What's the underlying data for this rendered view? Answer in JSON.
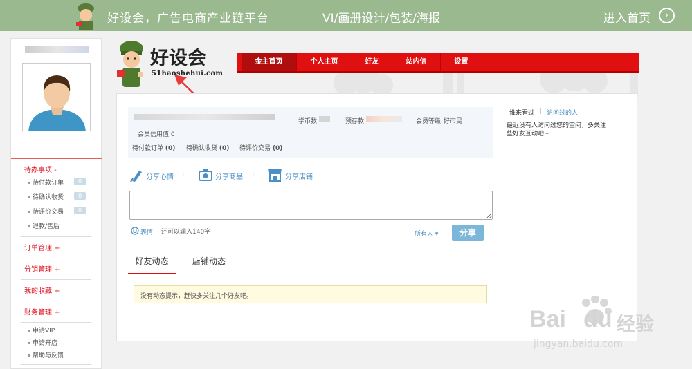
{
  "banner": {
    "title": "好设会，广告电商产业链平台",
    "subtitle": "VI/画册设计/包装/海报",
    "enter": "进入首页",
    "arrow": "›"
  },
  "sidebar": {
    "username": "··· ·····",
    "todo": {
      "label": "待办事项 -",
      "items": [
        {
          "label": "待付款订单",
          "count": "0"
        },
        {
          "label": "待确认收货",
          "count": "0"
        },
        {
          "label": "待评价交易",
          "count": "0"
        },
        {
          "label": "退款/售后"
        }
      ]
    },
    "orders": "订单管理 +",
    "dist": "分销管理 +",
    "fav": "我的收藏 +",
    "finance": "财务管理 +",
    "links": [
      "申请VIP",
      "申请开店",
      "帮助与反馈"
    ]
  },
  "logo": {
    "name": "好设会",
    "domain": "51haoshehui.com"
  },
  "nav": {
    "items": [
      "金主首页",
      "个人主页",
      "好友",
      "站内信",
      "设置"
    ]
  },
  "info": {
    "coin": "学币数",
    "deposit": "预存款",
    "level": "会员等级",
    "level_value": "好市民",
    "credit": "会员信用值 0",
    "pending_pay": "待付款订单",
    "pending_pay_n": "(0)",
    "pending_recv": "待确认收货",
    "pending_recv_n": "(0)",
    "pending_eval": "待评价交易",
    "pending_eval_n": "(0)"
  },
  "share": {
    "mood": "分享心情",
    "goods": "分享商品",
    "shop": "分享店铺"
  },
  "compose": {
    "emoji": "表情",
    "limit": "还可以输入140字",
    "audience": "所有人",
    "submit": "分享"
  },
  "feed": {
    "tab_friends": "好友动态",
    "tab_shops": "店铺动态",
    "empty": "没有动态提示，赶快多关注几个好友吧。"
  },
  "visitors": {
    "tab_who": "谁来看过",
    "divider": "|",
    "tab_visited": "访问过的人",
    "empty": "最近没有人访问过您的空间，多关注些好友互动吧~"
  },
  "watermark": {
    "brand": "Bai",
    "brand_tail": "du",
    "cn": "经验",
    "url": "jingyan.baidu.com"
  },
  "colors": {
    "accent": "#e01010",
    "banner": "#9ab98e",
    "link": "#4a90c6",
    "button": "#7cb6d8"
  }
}
